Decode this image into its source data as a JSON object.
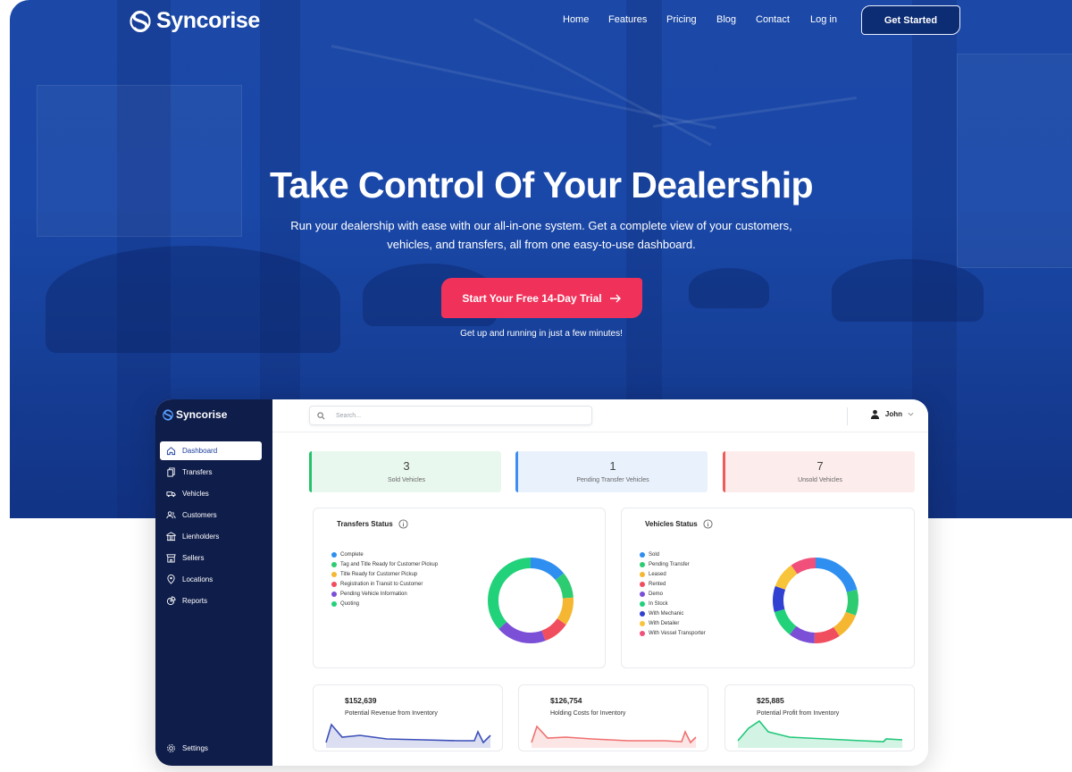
{
  "site": {
    "brand": "Syncorise",
    "nav": [
      "Home",
      "Features",
      "Pricing",
      "Blog",
      "Contact",
      "Log in"
    ],
    "cta_header": "Get Started"
  },
  "hero": {
    "title": "Take Control Of Your Dealership",
    "subtitle": "Run your dealership with ease with our all-in-one system. Get a complete view of your customers, vehicles, and transfers, all from one easy-to-use dashboard.",
    "cta": "Start Your Free 14-Day Trial",
    "note": "Get up and running in just a few minutes!"
  },
  "dashboard": {
    "brand": "Syncorise",
    "sidebar": [
      {
        "label": "Dashboard",
        "icon": "home-icon"
      },
      {
        "label": "Transfers",
        "icon": "copy-icon"
      },
      {
        "label": "Vehicles",
        "icon": "truck-icon"
      },
      {
        "label": "Customers",
        "icon": "users-icon"
      },
      {
        "label": "Lienholders",
        "icon": "building-icon"
      },
      {
        "label": "Sellers",
        "icon": "store-icon"
      },
      {
        "label": "Locations",
        "icon": "pin-icon"
      },
      {
        "label": "Reports",
        "icon": "pie-icon"
      }
    ],
    "settings": "Settings",
    "search_placeholder": "Search...",
    "user": "John",
    "stats": [
      {
        "value": "3",
        "label": "Sold Vehicles",
        "color": "#22c36b",
        "bg": "#e9f8ef"
      },
      {
        "value": "1",
        "label": "Pending Transfer Vehicles",
        "color": "#3d8ef0",
        "bg": "#e8f1fc"
      },
      {
        "value": "7",
        "label": "Unsold Vehicles",
        "color": "#ef5b5b",
        "bg": "#fdecec"
      }
    ],
    "transfers_status": {
      "title": "Transfers Status",
      "legend": [
        {
          "label": "Complete",
          "color": "#2f8ff0"
        },
        {
          "label": "Tag and Title Ready for Customer Pickup",
          "color": "#2ecc71"
        },
        {
          "label": "Title Ready for Customer Pickup",
          "color": "#f5b731"
        },
        {
          "label": "Registration in Transit to Customer",
          "color": "#f04d5e"
        },
        {
          "label": "Pending Vehicle Information",
          "color": "#7b4fd6"
        },
        {
          "label": "Quoting",
          "color": "#22d27a"
        }
      ]
    },
    "vehicles_status": {
      "title": "Vehicles Status",
      "legend": [
        {
          "label": "Sold",
          "color": "#2f8ff0"
        },
        {
          "label": "Pending Transfer",
          "color": "#2ecc71"
        },
        {
          "label": "Leased",
          "color": "#f5b731"
        },
        {
          "label": "Rented",
          "color": "#f04d5e"
        },
        {
          "label": "Demo",
          "color": "#7b4fd6"
        },
        {
          "label": "In Stock",
          "color": "#22d27a"
        },
        {
          "label": "With Mechanic",
          "color": "#3040d0"
        },
        {
          "label": "With Detailer",
          "color": "#f7c43a"
        },
        {
          "label": "With Vessel Transporter",
          "color": "#f0507a"
        }
      ]
    },
    "metrics": [
      {
        "amount": "$152,639",
        "label": "Potential Revenue from Inventory",
        "color": "#3b4fb8"
      },
      {
        "amount": "$126,754",
        "label": "Holding Costs for Inventory",
        "color": "#f07070"
      },
      {
        "amount": "$25,885",
        "label": "Potential Profit from Inventory",
        "color": "#22c77a"
      }
    ]
  }
}
